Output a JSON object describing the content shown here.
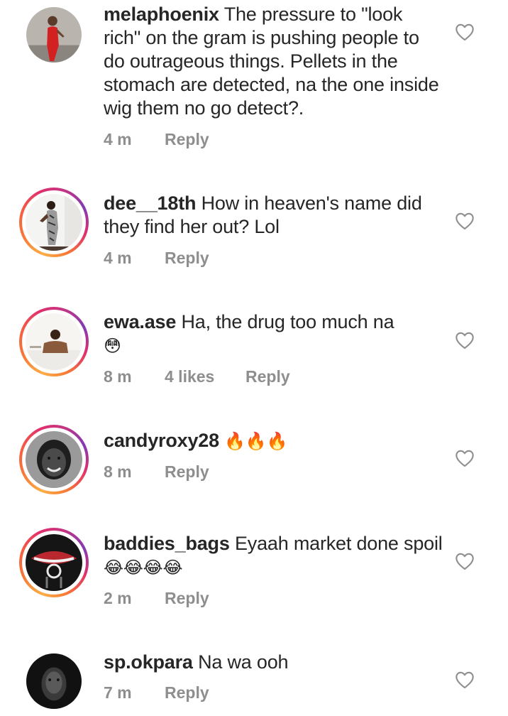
{
  "comments": [
    {
      "username": "melaphoenix",
      "text": "The pressure to \"look rich\" on the gram is pushing people to do outrageous things. Pellets in the stomach are detected, na the one inside wig them no go detect?.",
      "time": "4 m",
      "likes": "",
      "reply_label": "Reply",
      "avatar": "woman-in-red-dress",
      "story_ring": false
    },
    {
      "username": "dee__18th",
      "text": "How in heaven's name did they find her out? Lol",
      "time": "4 m",
      "likes": "",
      "reply_label": "Reply",
      "avatar": "woman-in-patterned-dress",
      "story_ring": true
    },
    {
      "username": "ewa.ase",
      "text": "Ha, the drug too much na",
      "emoji": "😳",
      "time": "8 m",
      "likes": "4 likes",
      "reply_label": "Reply",
      "avatar": "woman-seated",
      "story_ring": true
    },
    {
      "username": "candyroxy28",
      "text": "",
      "emoji": "🔥🔥🔥",
      "time": "8 m",
      "likes": "",
      "reply_label": "Reply",
      "avatar": "smiling-woman-bw",
      "story_ring": true
    },
    {
      "username": "baddies_bags",
      "text": "Eyaah market done spoil",
      "emoji": "😂😂😂😂",
      "time": "2 m",
      "likes": "",
      "reply_label": "Reply",
      "avatar": "lips-chanel-logo",
      "story_ring": true
    },
    {
      "username": "sp.okpara",
      "text": "Na wa ooh",
      "time": "7 m",
      "likes": "",
      "reply_label": "Reply",
      "avatar": "man-portrait-bw",
      "story_ring": false
    }
  ],
  "icons": {
    "like": "heart-outline-icon"
  },
  "colors": {
    "text": "#262626",
    "meta": "#8e8e8e",
    "heart": "#8e8e8e"
  }
}
